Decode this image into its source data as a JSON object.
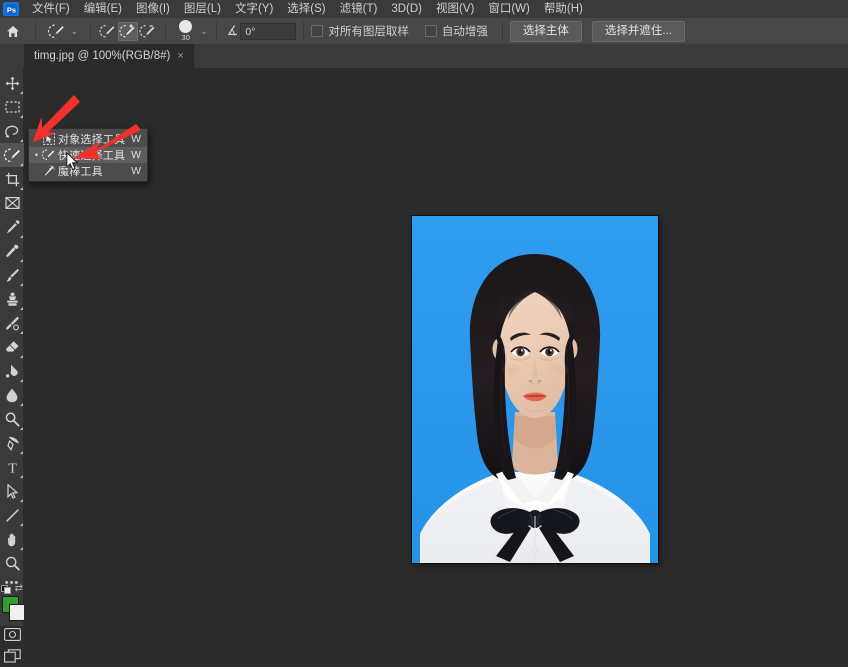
{
  "app": {
    "name": "Adobe Photoshop",
    "home_icon": "ps-home-icon",
    "colors": {
      "menubar_bg": "#3a3a3a",
      "optionsbar_bg": "#474747",
      "canvas_bg": "#2b2b2b",
      "panel_bg": "#3a3a3a",
      "accent": "#1473e6",
      "foreground_swatch": "#2fa02f",
      "background_swatch": "#f0f0ee",
      "arrow_red": "#f2312c",
      "photo_background": "#2e9bef"
    }
  },
  "menubar": {
    "items": [
      {
        "label": "文件(F)",
        "name": "menu-file"
      },
      {
        "label": "编辑(E)",
        "name": "menu-edit"
      },
      {
        "label": "图像(I)",
        "name": "menu-image"
      },
      {
        "label": "图层(L)",
        "name": "menu-layer"
      },
      {
        "label": "文字(Y)",
        "name": "menu-type"
      },
      {
        "label": "选择(S)",
        "name": "menu-select"
      },
      {
        "label": "滤镜(T)",
        "name": "menu-filter"
      },
      {
        "label": "3D(D)",
        "name": "menu-3d"
      },
      {
        "label": "视图(V)",
        "name": "menu-view"
      },
      {
        "label": "窗口(W)",
        "name": "menu-window"
      },
      {
        "label": "帮助(H)",
        "name": "menu-help"
      }
    ]
  },
  "options_bar": {
    "tool_preset_icon": "quick-selection-tool-icon",
    "preset_chevron": "⌄",
    "modes": [
      {
        "name": "new-selection-mode",
        "icon": "brush-new-selection-icon",
        "selected": false
      },
      {
        "name": "add-to-selection-mode",
        "icon": "brush-add-selection-icon",
        "selected": true
      },
      {
        "name": "subtract-from-selection-mode",
        "icon": "brush-subtract-selection-icon",
        "selected": false
      }
    ],
    "brush": {
      "size_value": "30",
      "picker_chevron": "⌄",
      "angle_glyph": "∡",
      "angle_value": "0°"
    },
    "checkboxes": [
      {
        "label": "对所有图层取样",
        "name": "sample-all-layers-checkbox",
        "checked": false
      },
      {
        "label": "自动增强",
        "name": "auto-enhance-checkbox",
        "checked": false
      }
    ],
    "buttons": [
      {
        "label": "选择主体",
        "name": "select-subject-button"
      },
      {
        "label": "选择并遮住...",
        "name": "select-and-mask-button"
      }
    ]
  },
  "tabs": [
    {
      "label": "timg.jpg @ 100%(RGB/8#)",
      "close_glyph": "×",
      "active": true,
      "name": "tab-timg-jpg"
    }
  ],
  "toolbar": {
    "items": [
      {
        "name": "move-tool",
        "icon": "move-tool-icon",
        "has_corner": true,
        "active": false
      },
      {
        "name": "rectangular-marquee-tool",
        "icon": "marquee-tool-icon",
        "has_corner": true,
        "active": false
      },
      {
        "name": "lasso-tool",
        "icon": "lasso-tool-icon",
        "has_corner": true,
        "active": false
      },
      {
        "name": "quick-selection-tool",
        "icon": "quick-selection-tool-icon",
        "has_corner": true,
        "active": true
      },
      {
        "name": "crop-tool",
        "icon": "crop-tool-icon",
        "has_corner": true,
        "active": false
      },
      {
        "name": "frame-tool",
        "icon": "frame-tool-icon",
        "has_corner": false,
        "active": false
      },
      {
        "name": "eyedropper-tool",
        "icon": "eyedropper-tool-icon",
        "has_corner": true,
        "active": false
      },
      {
        "name": "spot-healing-brush-tool",
        "icon": "healing-brush-tool-icon",
        "has_corner": true,
        "active": false
      },
      {
        "name": "brush-tool",
        "icon": "brush-tool-icon",
        "has_corner": true,
        "active": false
      },
      {
        "name": "clone-stamp-tool",
        "icon": "clone-stamp-tool-icon",
        "has_corner": true,
        "active": false
      },
      {
        "name": "history-brush-tool",
        "icon": "history-brush-tool-icon",
        "has_corner": true,
        "active": false
      },
      {
        "name": "eraser-tool",
        "icon": "eraser-tool-icon",
        "has_corner": true,
        "active": false
      },
      {
        "name": "gradient-tool",
        "icon": "gradient-bucket-tool-icon",
        "has_corner": true,
        "active": false
      },
      {
        "name": "blur-tool",
        "icon": "blur-droplet-tool-icon",
        "has_corner": true,
        "active": false
      },
      {
        "name": "dodge-tool",
        "icon": "dodge-tool-icon",
        "has_corner": true,
        "active": false
      },
      {
        "name": "pen-tool",
        "icon": "pen-tool-icon",
        "has_corner": true,
        "active": false
      },
      {
        "name": "type-tool",
        "icon": "type-tool-icon",
        "has_corner": true,
        "active": false
      },
      {
        "name": "path-selection-tool",
        "icon": "path-selection-arrow-icon",
        "has_corner": true,
        "active": false
      },
      {
        "name": "line-shape-tool",
        "icon": "line-shape-tool-icon",
        "has_corner": true,
        "active": false
      },
      {
        "name": "hand-tool",
        "icon": "hand-tool-icon",
        "has_corner": true,
        "active": false
      },
      {
        "name": "zoom-tool",
        "icon": "zoom-magnifier-tool-icon",
        "has_corner": false,
        "active": false
      }
    ],
    "more_tools_glyph": "•••",
    "swap_glyph": "⇄",
    "quick_mask_icon": "quick-mask-icon",
    "screen_mode_icon": "screen-mode-icon"
  },
  "flyout_menu": {
    "items": [
      {
        "label": "对象选择工具",
        "shortcut": "W",
        "icon": "object-selection-tool-icon",
        "selected": false,
        "highlighted": false,
        "name": "flyout-object-selection-tool"
      },
      {
        "label": "快速选择工具",
        "shortcut": "W",
        "icon": "quick-selection-tool-icon",
        "selected": true,
        "highlighted": true,
        "name": "flyout-quick-selection-tool"
      },
      {
        "label": "魔棒工具",
        "shortcut": "W",
        "icon": "magic-wand-tool-icon",
        "selected": false,
        "highlighted": false,
        "name": "flyout-magic-wand-tool"
      }
    ],
    "bullet_glyph": "•"
  },
  "document": {
    "photo_alt": "ID portrait photo — young woman, blue background, white shirt, black bow tie",
    "zoom": "100%",
    "color_mode": "RGB/8#"
  },
  "annotations": {
    "arrow_color": "#f2312c",
    "arrow_count": 2,
    "arrow_1_target": "quick-selection-toolbar-button",
    "arrow_2_target": "flyout-quick-selection-tool"
  }
}
